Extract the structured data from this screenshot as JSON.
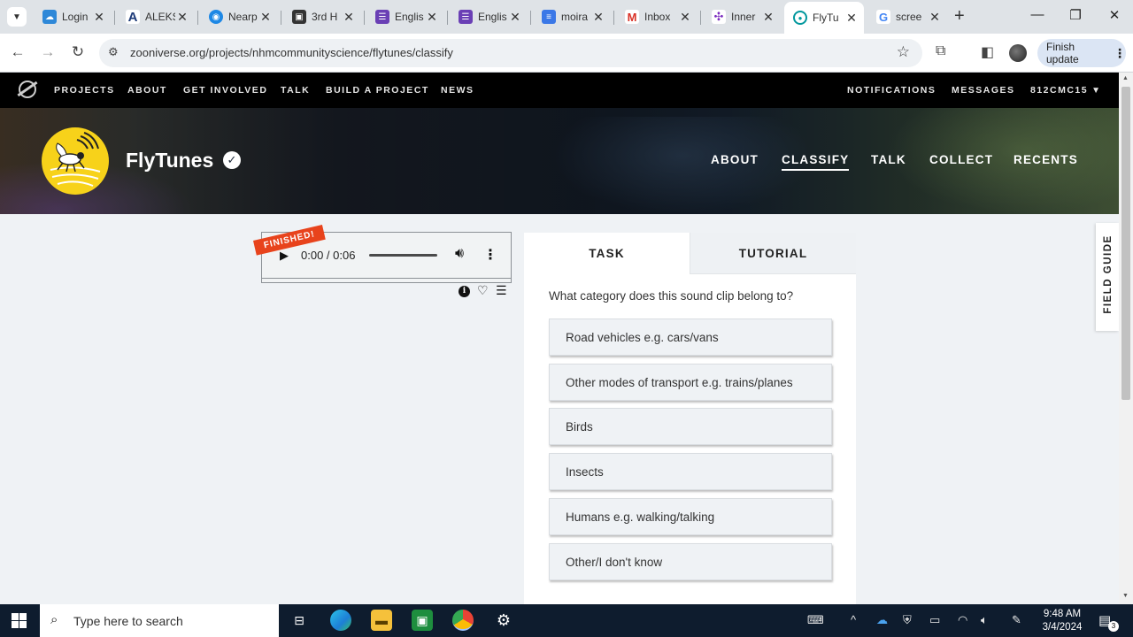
{
  "browser": {
    "tabs": [
      {
        "title": "Login",
        "icon": "cloud-icon",
        "color": "#2e88d8"
      },
      {
        "title": "ALEKS",
        "icon": "aleks-icon",
        "color": "#1d3a78"
      },
      {
        "title": "Nearp",
        "icon": "nearpod-icon",
        "color": "#1e88e5"
      },
      {
        "title": "3rd H",
        "icon": "classroom-icon",
        "color": "#333333"
      },
      {
        "title": "Englis",
        "icon": "forms-icon",
        "color": "#6a3fb5"
      },
      {
        "title": "Englis",
        "icon": "forms-icon",
        "color": "#6a3fb5"
      },
      {
        "title": "moira",
        "icon": "docs-icon",
        "color": "#3b78e7"
      },
      {
        "title": "Inbox",
        "icon": "gmail-icon",
        "color": "#d93025"
      },
      {
        "title": "Inner",
        "icon": "inner-icon",
        "color": "#7b2cbf"
      },
      {
        "title": "FlyTu",
        "icon": "zooniverse-icon",
        "color": "#00979d"
      },
      {
        "title": "scree",
        "icon": "google-icon",
        "color": "#4285f4"
      }
    ],
    "active_tab": 9,
    "url": "zooniverse.org/projects/nhmcommunityscience/flytunes/classify",
    "finish_update_label": "Finish update"
  },
  "zoo_nav": {
    "links": [
      "PROJECTS",
      "ABOUT",
      "GET INVOLVED",
      "TALK",
      "BUILD A PROJECT",
      "NEWS"
    ],
    "right_links": [
      "NOTIFICATIONS",
      "MESSAGES"
    ],
    "user": "812CMC15"
  },
  "project": {
    "title": "FlyTunes",
    "links": [
      "ABOUT",
      "CLASSIFY",
      "TALK",
      "COLLECT",
      "RECENTS"
    ],
    "active_link": "CLASSIFY"
  },
  "subject": {
    "status_banner": "FINISHED!",
    "time": "0:00 / 0:06",
    "progress": 0
  },
  "task": {
    "tabs": [
      "TASK",
      "TUTORIAL"
    ],
    "question": "What category does this sound clip belong to?",
    "answers": [
      "Road vehicles e.g. cars/vans",
      "Other modes of transport e.g. trains/planes",
      "Birds",
      "Insects",
      "Humans e.g. walking/talking",
      "Other/I don't know"
    ]
  },
  "field_guide_label": "FIELD GUIDE",
  "taskbar": {
    "search_placeholder": "Type here to search",
    "time": "9:48 AM",
    "date": "3/4/2024",
    "notification_count": "3"
  },
  "colors": {
    "accent_banner": "#e8431c",
    "project_avatar": "#f7d21a",
    "nav_bg": "#000000",
    "page_bg": "#eff2f5"
  }
}
